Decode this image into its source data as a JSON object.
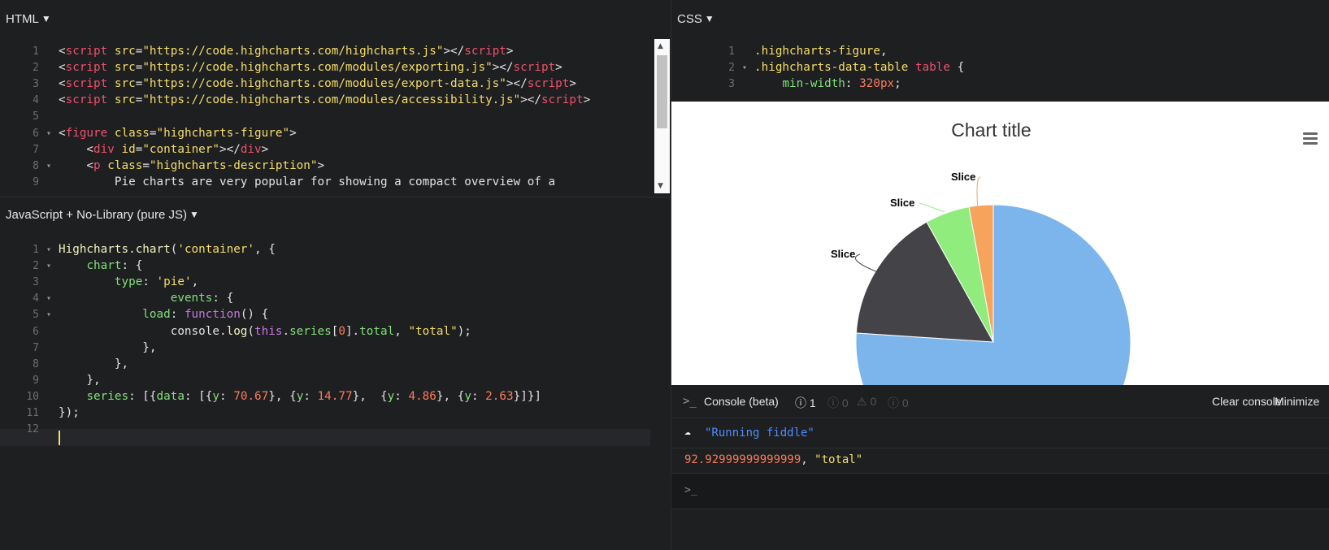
{
  "html_panel": {
    "title": "HTML",
    "lines": [
      {
        "n": "1",
        "fold": "",
        "tokens": [
          [
            "t-punc",
            "<"
          ],
          [
            "t-tag",
            "script"
          ],
          [
            "t-attr",
            " src"
          ],
          [
            "t-punc",
            "="
          ],
          [
            "t-str",
            "\"https://code.highcharts.com/highcharts.js\""
          ],
          [
            "t-punc",
            ">"
          ],
          [
            "t-punc",
            "</"
          ],
          [
            "t-tag",
            "script"
          ],
          [
            "t-punc",
            ">"
          ]
        ]
      },
      {
        "n": "2",
        "fold": "",
        "tokens": [
          [
            "t-punc",
            "<"
          ],
          [
            "t-tag",
            "script"
          ],
          [
            "t-attr",
            " src"
          ],
          [
            "t-punc",
            "="
          ],
          [
            "t-str",
            "\"https://code.highcharts.com/modules/exporting.js\""
          ],
          [
            "t-punc",
            ">"
          ],
          [
            "t-punc",
            "</"
          ],
          [
            "t-tag",
            "script"
          ],
          [
            "t-punc",
            ">"
          ]
        ]
      },
      {
        "n": "3",
        "fold": "",
        "tokens": [
          [
            "t-punc",
            "<"
          ],
          [
            "t-tag",
            "script"
          ],
          [
            "t-attr",
            " src"
          ],
          [
            "t-punc",
            "="
          ],
          [
            "t-str",
            "\"https://code.highcharts.com/modules/export-data.js\""
          ],
          [
            "t-punc",
            ">"
          ],
          [
            "t-punc",
            "</"
          ],
          [
            "t-tag",
            "script"
          ],
          [
            "t-punc",
            ">"
          ]
        ]
      },
      {
        "n": "4",
        "fold": "",
        "tokens": [
          [
            "t-punc",
            "<"
          ],
          [
            "t-tag",
            "script"
          ],
          [
            "t-attr",
            " src"
          ],
          [
            "t-punc",
            "="
          ],
          [
            "t-str",
            "\"https://code.highcharts.com/modules/accessibility.js\""
          ],
          [
            "t-punc",
            ">"
          ],
          [
            "t-punc",
            "</"
          ],
          [
            "t-tag",
            "script"
          ],
          [
            "t-punc",
            ">"
          ]
        ]
      },
      {
        "n": "5",
        "fold": "",
        "tokens": []
      },
      {
        "n": "6",
        "fold": "▾",
        "tokens": [
          [
            "t-punc",
            "<"
          ],
          [
            "t-tag",
            "figure"
          ],
          [
            "t-attr",
            " class"
          ],
          [
            "t-punc",
            "="
          ],
          [
            "t-str",
            "\"highcharts-figure\""
          ],
          [
            "t-punc",
            ">"
          ]
        ]
      },
      {
        "n": "7",
        "fold": "",
        "tokens": [
          [
            "t-punc",
            "    <"
          ],
          [
            "t-tag",
            "div"
          ],
          [
            "t-attr",
            " id"
          ],
          [
            "t-punc",
            "="
          ],
          [
            "t-str",
            "\"container\""
          ],
          [
            "t-punc",
            "></"
          ],
          [
            "t-tag",
            "div"
          ],
          [
            "t-punc",
            ">"
          ]
        ]
      },
      {
        "n": "8",
        "fold": "▾",
        "tokens": [
          [
            "t-punc",
            "    <"
          ],
          [
            "t-tag",
            "p"
          ],
          [
            "t-attr",
            " class"
          ],
          [
            "t-punc",
            "="
          ],
          [
            "t-str",
            "\"highcharts-description\""
          ],
          [
            "t-punc",
            ">"
          ]
        ]
      },
      {
        "n": "9",
        "fold": "",
        "tokens": [
          [
            "t-punc",
            "        Pie charts are very popular for showing a compact overview of a"
          ]
        ]
      }
    ]
  },
  "js_panel": {
    "title": "JavaScript + No-Library (pure JS)",
    "lines": [
      {
        "n": "1",
        "fold": "▾",
        "tokens": [
          [
            "t-fn",
            "Highcharts"
          ],
          [
            "t-punc",
            "."
          ],
          [
            "t-fn",
            "chart"
          ],
          [
            "t-punc",
            "("
          ],
          [
            "t-str",
            "'container'"
          ],
          [
            "t-punc",
            ", {"
          ]
        ]
      },
      {
        "n": "2",
        "fold": "▾",
        "tokens": [
          [
            "t-punc",
            "    "
          ],
          [
            "t-prop",
            "chart"
          ],
          [
            "t-punc",
            ": {"
          ]
        ]
      },
      {
        "n": "3",
        "fold": "",
        "tokens": [
          [
            "t-punc",
            "        "
          ],
          [
            "t-prop",
            "type"
          ],
          [
            "t-punc",
            ": "
          ],
          [
            "t-str",
            "'pie'"
          ],
          [
            "t-punc",
            ","
          ]
        ]
      },
      {
        "n": "4",
        "fold": "▾",
        "tokens": [
          [
            "t-punc",
            "                "
          ],
          [
            "t-prop",
            "events"
          ],
          [
            "t-punc",
            ": {"
          ]
        ]
      },
      {
        "n": "5",
        "fold": "▾",
        "tokens": [
          [
            "t-punc",
            "            "
          ],
          [
            "t-prop",
            "load"
          ],
          [
            "t-punc",
            ": "
          ],
          [
            "t-kw",
            "function"
          ],
          [
            "t-punc",
            "() {"
          ]
        ]
      },
      {
        "n": "6",
        "fold": "",
        "tokens": [
          [
            "t-punc",
            "                console."
          ],
          [
            "t-fn",
            "log"
          ],
          [
            "t-punc",
            "("
          ],
          [
            "t-kw",
            "this"
          ],
          [
            "t-punc",
            "."
          ],
          [
            "t-prop",
            "series"
          ],
          [
            "t-punc",
            "["
          ],
          [
            "t-num",
            "0"
          ],
          [
            "t-punc",
            "]."
          ],
          [
            "t-prop",
            "total"
          ],
          [
            "t-punc",
            ", "
          ],
          [
            "t-str",
            "\"total\""
          ],
          [
            "t-punc",
            ");"
          ]
        ]
      },
      {
        "n": "7",
        "fold": "",
        "tokens": [
          [
            "t-punc",
            "            },"
          ]
        ]
      },
      {
        "n": "8",
        "fold": "",
        "tokens": [
          [
            "t-punc",
            "        },"
          ]
        ]
      },
      {
        "n": "9",
        "fold": "",
        "tokens": [
          [
            "t-punc",
            "    },"
          ]
        ]
      },
      {
        "n": "10",
        "fold": "",
        "tokens": [
          [
            "t-punc",
            "    "
          ],
          [
            "t-prop",
            "series"
          ],
          [
            "t-punc",
            ": [{"
          ],
          [
            "t-prop",
            "data"
          ],
          [
            "t-punc",
            ": [{"
          ],
          [
            "t-prop",
            "y"
          ],
          [
            "t-punc",
            ": "
          ],
          [
            "t-num",
            "70.67"
          ],
          [
            "t-punc",
            "}, {"
          ],
          [
            "t-prop",
            "y"
          ],
          [
            "t-punc",
            ": "
          ],
          [
            "t-num",
            "14.77"
          ],
          [
            "t-punc",
            "},  {"
          ],
          [
            "t-prop",
            "y"
          ],
          [
            "t-punc",
            ": "
          ],
          [
            "t-num",
            "4.86"
          ],
          [
            "t-punc",
            "}, {"
          ],
          [
            "t-prop",
            "y"
          ],
          [
            "t-punc",
            ": "
          ],
          [
            "t-num",
            "2.63"
          ],
          [
            "t-punc",
            "}]}]"
          ]
        ]
      },
      {
        "n": "11",
        "fold": "",
        "tokens": [
          [
            "t-punc",
            "});"
          ]
        ]
      },
      {
        "n": "12",
        "fold": "",
        "tokens": []
      }
    ]
  },
  "css_panel": {
    "title": "CSS",
    "lines": [
      {
        "n": "1",
        "fold": "",
        "tokens": [
          [
            "t-str",
            ".highcharts-figure"
          ],
          [
            "t-punc",
            ","
          ]
        ]
      },
      {
        "n": "2",
        "fold": "▾",
        "tokens": [
          [
            "t-str",
            ".highcharts-data-table"
          ],
          [
            "t-tag",
            " table"
          ],
          [
            "t-punc",
            " {"
          ]
        ]
      },
      {
        "n": "3",
        "fold": "",
        "tokens": [
          [
            "t-punc",
            "    "
          ],
          [
            "t-prop",
            "min-width"
          ],
          [
            "t-punc",
            ": "
          ],
          [
            "t-num",
            "320px"
          ],
          [
            "t-punc",
            ";"
          ]
        ]
      }
    ]
  },
  "chart_data": {
    "type": "pie",
    "title": "Chart title",
    "values": [
      70.67,
      14.77,
      4.86,
      2.63
    ],
    "labels": [
      "",
      "Slice",
      "Slice",
      "Slice"
    ],
    "colors": [
      "#7cb5ec",
      "#434348",
      "#90ed7d",
      "#f7a35c"
    ]
  },
  "console": {
    "title": "Console (beta)",
    "error_count": "1",
    "warn_count": "0",
    "alert_count": "0",
    "info_count": "0",
    "clear_label": "Clear console",
    "minimize_label": "Minimize",
    "running_msg": "\"Running fiddle\"",
    "log_value": "92.92999999999999",
    "log_sep": ", ",
    "log_string": "\"total\"",
    "prompt": ">_"
  }
}
